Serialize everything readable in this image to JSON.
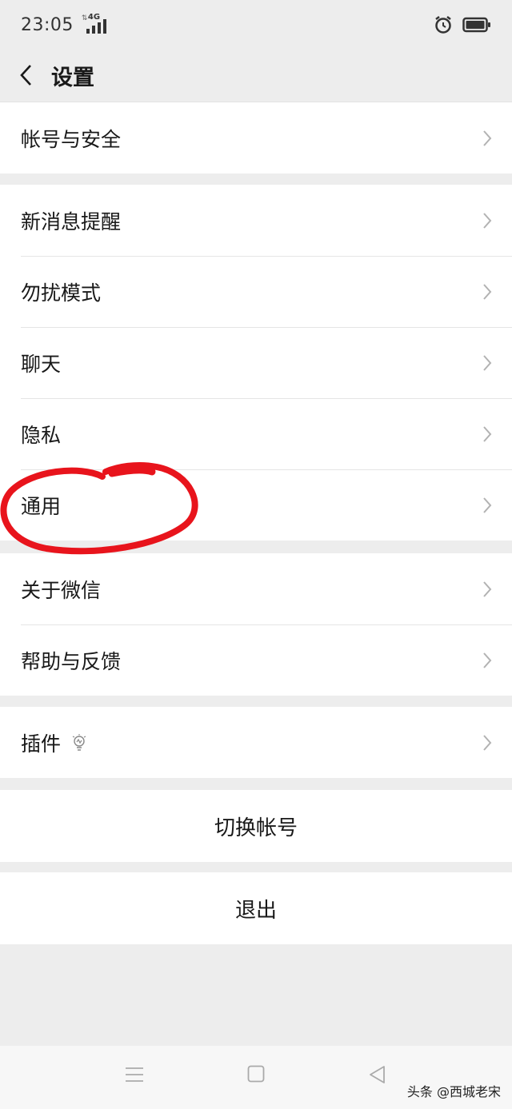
{
  "status_bar": {
    "time": "23:05",
    "network": "4G"
  },
  "header": {
    "title": "设置"
  },
  "groups": {
    "account": {
      "items": [
        {
          "label": "帐号与安全"
        }
      ]
    },
    "settings": {
      "items": [
        {
          "label": "新消息提醒"
        },
        {
          "label": "勿扰模式"
        },
        {
          "label": "聊天"
        },
        {
          "label": "隐私"
        },
        {
          "label": "通用"
        }
      ]
    },
    "about": {
      "items": [
        {
          "label": "关于微信"
        },
        {
          "label": "帮助与反馈"
        }
      ]
    },
    "plugins": {
      "items": [
        {
          "label": "插件"
        }
      ]
    }
  },
  "actions": {
    "switch_account": "切换帐号",
    "logout": "退出"
  },
  "watermark": "头条 @西城老宋",
  "colors": {
    "background": "#ededed",
    "card": "#ffffff",
    "annotation": "#e8141c"
  },
  "icons": {
    "back": "chevron-left-icon",
    "row": "chevron-right-icon",
    "plugins": "lightbulb-icon",
    "alarm": "alarm-icon",
    "battery": "battery-icon"
  }
}
